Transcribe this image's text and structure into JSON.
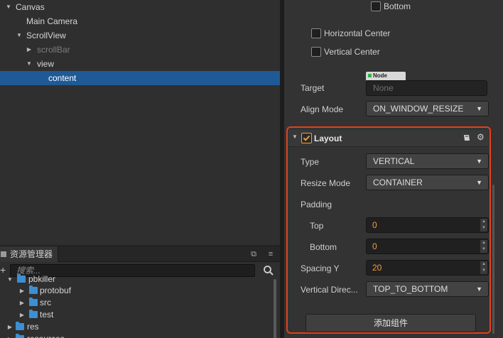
{
  "hierarchy": {
    "items": [
      {
        "label": "Canvas",
        "expanded": true
      },
      {
        "label": "Main Camera"
      },
      {
        "label": "ScrollView",
        "expanded": true
      },
      {
        "label": "scrollBar",
        "expanded": false,
        "dimmed": true
      },
      {
        "label": "view",
        "expanded": true
      },
      {
        "label": "content",
        "selected": true
      }
    ]
  },
  "assets": {
    "tab_title": "资源管理器",
    "search": {
      "placeholder": "搜索..."
    },
    "items": [
      {
        "label": "pbkiller"
      },
      {
        "label": "protobuf"
      },
      {
        "label": "src"
      },
      {
        "label": "test"
      },
      {
        "label": "res"
      },
      {
        "label": "resources"
      }
    ]
  },
  "inspector": {
    "widget": {
      "bottom_label": "Bottom",
      "horizontal_center_label": "Horizontal Center",
      "vertical_center_label": "Vertical Center",
      "target_label": "Target",
      "target_tag": "Node",
      "target_value": "None",
      "align_mode_label": "Align Mode",
      "align_mode_value": "ON_WINDOW_RESIZE"
    },
    "layout": {
      "title": "Layout",
      "enabled": true,
      "type_label": "Type",
      "type_value": "VERTICAL",
      "resize_mode_label": "Resize Mode",
      "resize_mode_value": "CONTAINER",
      "padding_label": "Padding",
      "top_label": "Top",
      "top_value": "0",
      "bottom_label": "Bottom",
      "bottom_value": "0",
      "spacing_y_label": "Spacing Y",
      "spacing_y_value": "20",
      "vertical_direction_label": "Vertical Direc...",
      "vertical_direction_value": "TOP_TO_BOTTOM"
    },
    "add_component_label": "添加组件"
  },
  "colors": {
    "selection": "#1f5a96",
    "highlight_border": "#e2401b",
    "number_value": "#f0a03a",
    "folder": "#3d8fd1",
    "checkbox_checked": "#f0a03a"
  }
}
